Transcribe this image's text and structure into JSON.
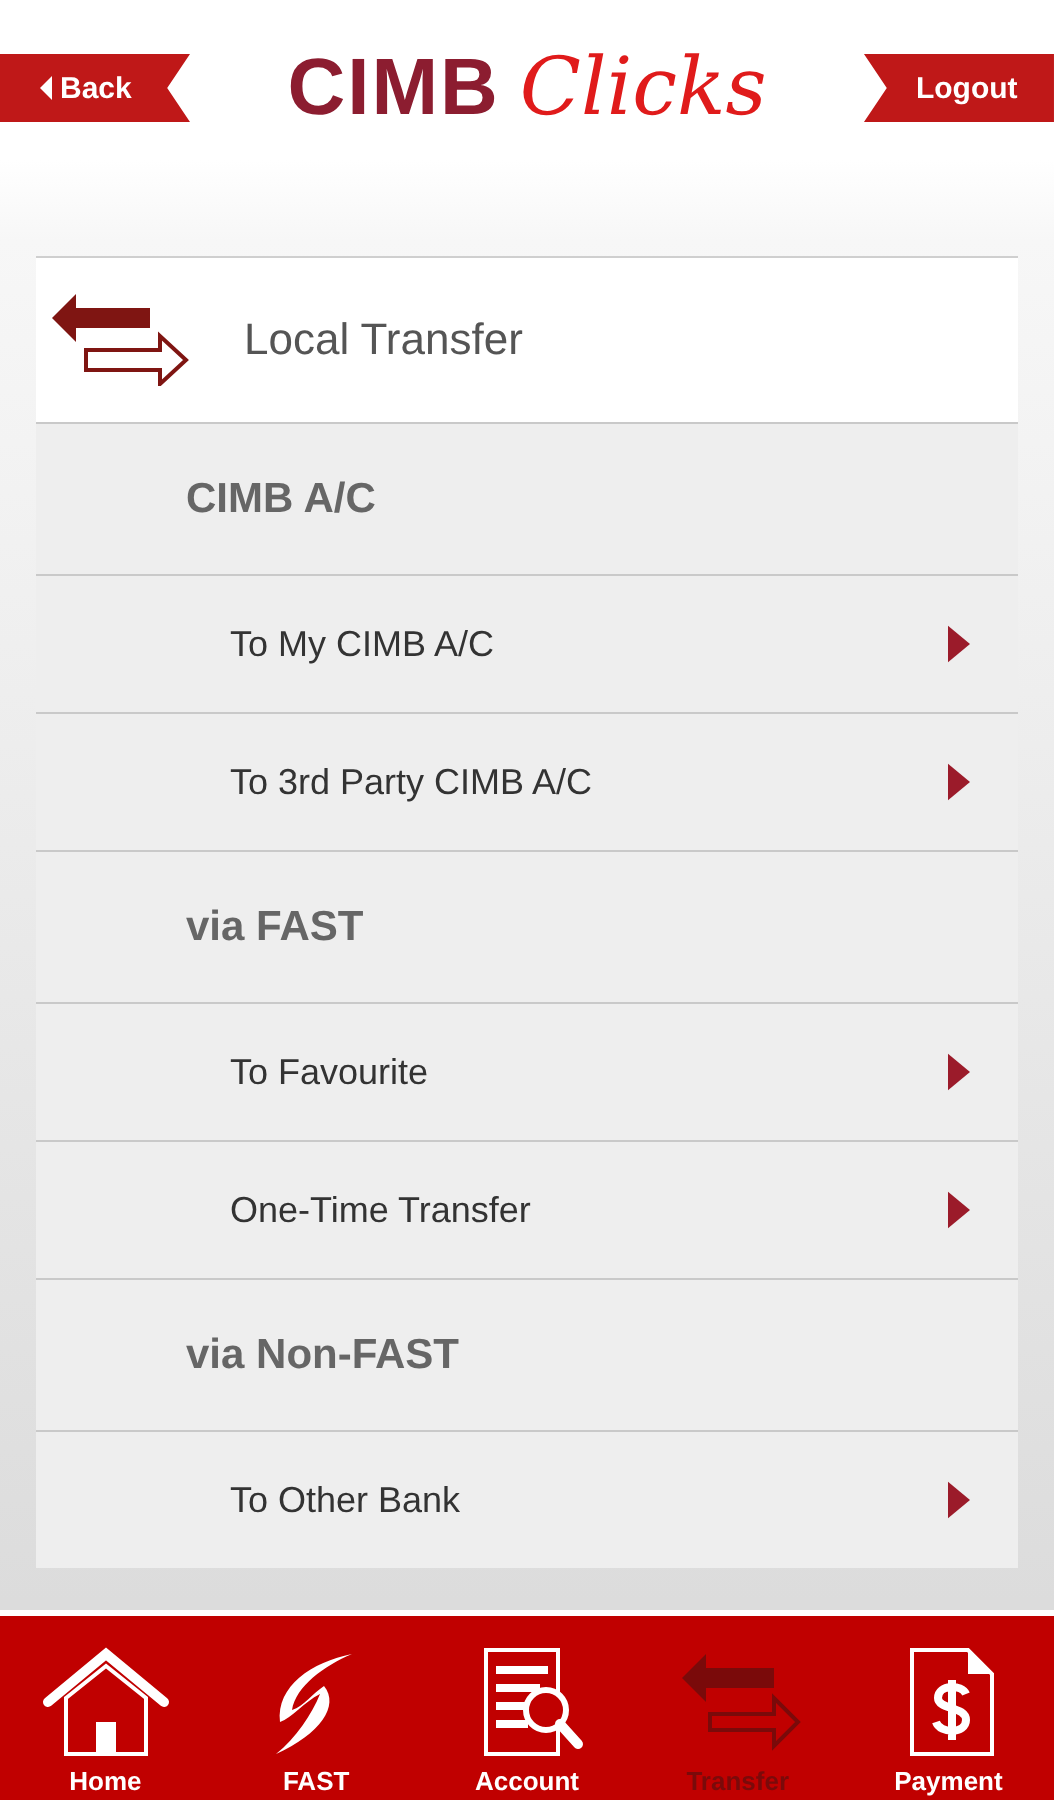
{
  "header": {
    "back": "Back",
    "logo_bold": "CIMB",
    "logo_script": "Clicks",
    "logout": "Logout"
  },
  "panel": {
    "title": "Local Transfer",
    "rows": [
      {
        "kind": "heading",
        "label": "CIMB A/C"
      },
      {
        "kind": "link",
        "label": "To My CIMB A/C"
      },
      {
        "kind": "link",
        "label": "To 3rd Party CIMB A/C"
      },
      {
        "kind": "heading",
        "label": "via FAST"
      },
      {
        "kind": "link",
        "label": "To Favourite"
      },
      {
        "kind": "link",
        "label": "One-Time Transfer"
      },
      {
        "kind": "heading",
        "label": "via Non-FAST"
      },
      {
        "kind": "link",
        "label": "To Other Bank"
      }
    ]
  },
  "tabs": [
    {
      "label": "Home",
      "selected": false
    },
    {
      "label": "FAST",
      "selected": false
    },
    {
      "label": "Account",
      "selected": false
    },
    {
      "label": "Transfer",
      "selected": true
    },
    {
      "label": "Payment",
      "selected": false
    }
  ]
}
